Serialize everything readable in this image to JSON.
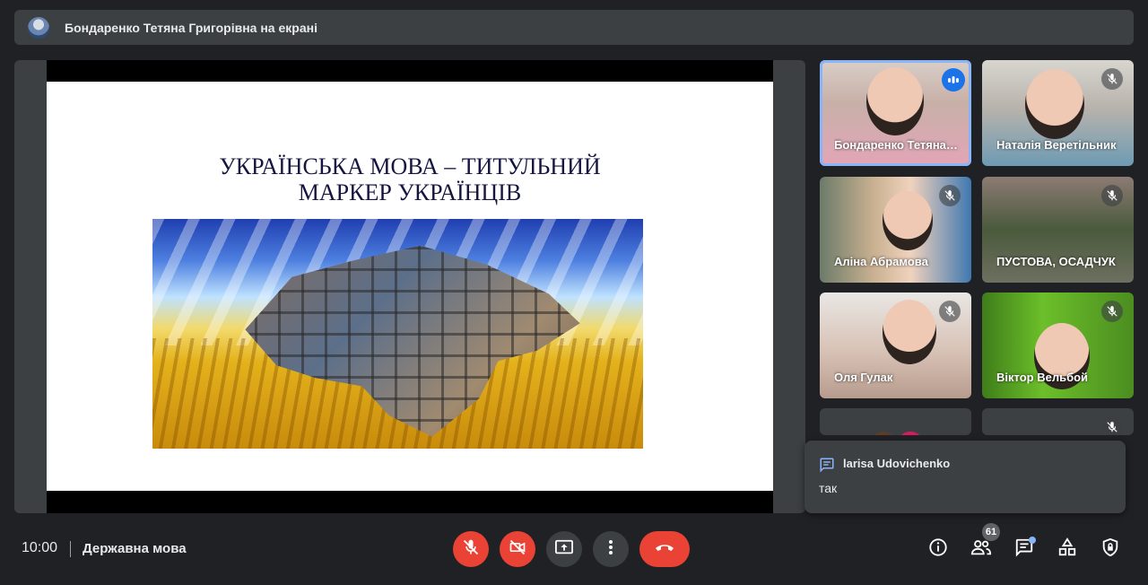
{
  "header": {
    "presenter_text": "Бондаренко Тетяна Григорівна на екрані",
    "avatar_icon": "user-avatar"
  },
  "slide": {
    "title_line1": "УКРАЇНСЬКА МОВА – ТИТУЛЬНИЙ",
    "title_line2": "МАРКЕР УКРАЇНЦІВ",
    "image": "ukraine-map-collage"
  },
  "participants": [
    {
      "name": "Бондаренко Тетяна Григорівна",
      "speaking": true
    },
    {
      "name": "Наталія Веретільник",
      "muted": true
    },
    {
      "name": "Аліна Абрамова",
      "muted": true
    },
    {
      "name": "ПУСТОВА, ОСАДЧУК",
      "muted": true
    },
    {
      "name": "Оля Гулак",
      "muted": true
    },
    {
      "name": "Віктор Вельбой",
      "muted": true
    },
    {
      "name": "",
      "muted": false
    },
    {
      "name": "",
      "muted": true
    }
  ],
  "chat_toast": {
    "sender": "larisa Udovichenko",
    "message": "так",
    "icon": "chat-bubble-icon"
  },
  "bottom": {
    "time": "10:00",
    "meeting": "Державна мова",
    "participant_count": "61"
  },
  "colors": {
    "background": "#202124",
    "surface": "#3c4043",
    "danger": "#ea4335",
    "accent": "#8ab4f8",
    "speaking": "#1a73e8"
  }
}
